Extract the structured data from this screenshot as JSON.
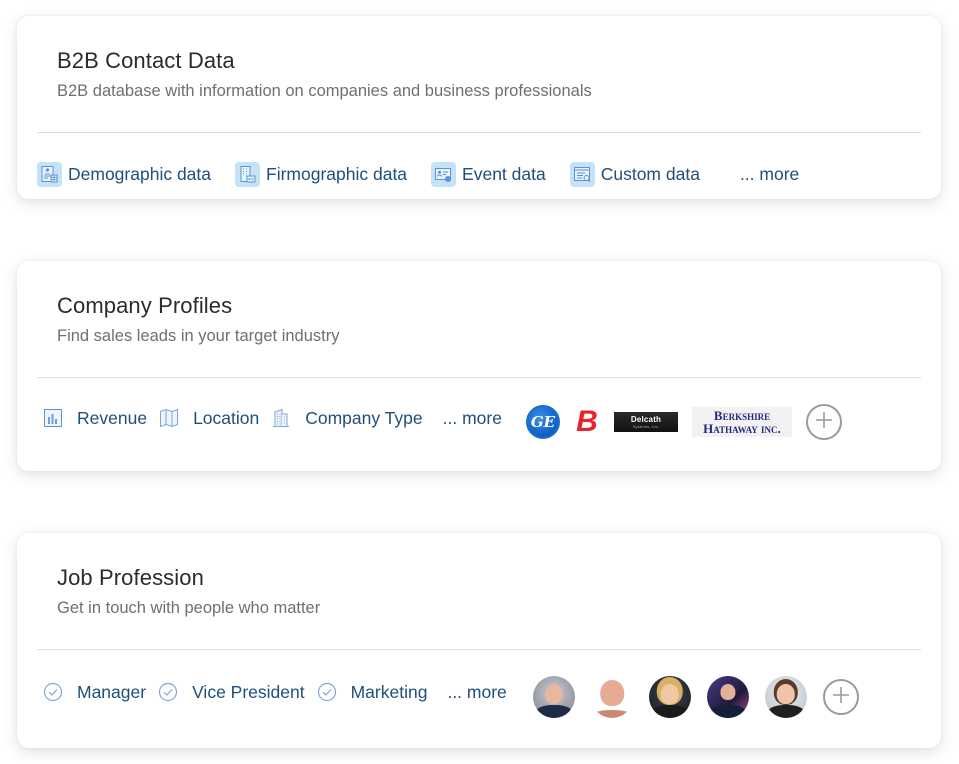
{
  "cards": [
    {
      "title": "B2B Contact Data",
      "subtitle": "B2B database with information on companies and business professionals",
      "tags": [
        {
          "label": "Demographic data",
          "icon": "demographic-data-icon"
        },
        {
          "label": "Firmographic data",
          "icon": "firmographic-data-icon"
        },
        {
          "label": "Event data",
          "icon": "event-data-icon"
        },
        {
          "label": "Custom data",
          "icon": "custom-data-icon"
        }
      ],
      "more_label": "... more"
    },
    {
      "title": "Company Profiles",
      "subtitle": "Find sales leads in your target industry",
      "tags": [
        {
          "label": "Revenue",
          "icon": "bar-chart-icon"
        },
        {
          "label": "Location",
          "icon": "map-icon"
        },
        {
          "label": "Company Type",
          "icon": "building-icon"
        }
      ],
      "more_label": "... more",
      "logos": [
        {
          "name": "GE",
          "text": "GE"
        },
        {
          "name": "Brand B",
          "text": "B"
        },
        {
          "name": "Delcath Systems",
          "text": "Delcath",
          "subtext": "Systems, Inc."
        },
        {
          "name": "Berkshire Hathaway Inc.",
          "line1": "Berkshire",
          "line2": "Hathaway inc."
        }
      ],
      "add_icon": "plus-icon"
    },
    {
      "title": "Job Profession",
      "subtitle": "Get in touch with people who matter",
      "tags": [
        {
          "label": "Manager",
          "icon": "check-circle-icon"
        },
        {
          "label": "Vice President",
          "icon": "check-circle-icon"
        },
        {
          "label": "Marketing",
          "icon": "check-circle-icon"
        }
      ],
      "more_label": "... more",
      "avatars_count": 5,
      "add_icon": "plus-icon"
    }
  ],
  "colors": {
    "title": "#2b2b2b",
    "subtitle": "#6f6f6f",
    "link": "#1f4f7a",
    "divider": "#c9e2ef",
    "icon_bg": "#c6e2f7",
    "icon_stroke": "#5b93d6"
  }
}
